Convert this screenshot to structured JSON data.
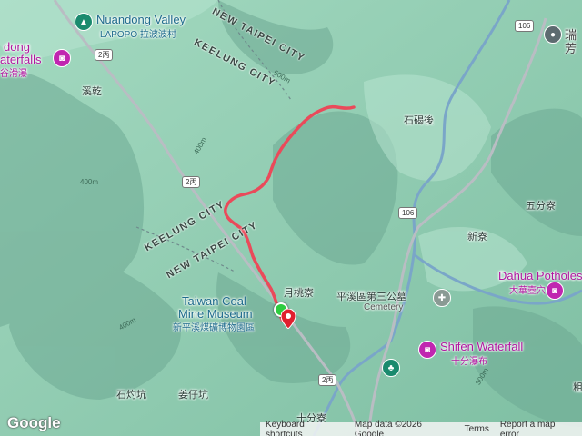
{
  "colors": {
    "track": "#ea4a5a",
    "water": "#7aa6c8",
    "road": "#b9bdc3",
    "terrain": "#8fcfb3"
  },
  "places": {
    "nuandong_valley_en": "Nuandong Valley",
    "nuandong_valley_zh": "LAPOPO 拉波波村",
    "waterfalls_en_1": "dong",
    "waterfalls_en_2": "aterfalls",
    "waterfalls_zh": "谷滑瀑",
    "xigan": "溪乾",
    "shikehou": "石碣後",
    "wufenliao": "五分寮",
    "xinliao": "新寮",
    "dahua_en": "Dahua Potholes",
    "dahua_zh": "大華壺穴",
    "yuetaoliao": "月桃寮",
    "cemetery_zh": "平溪區第三公墓",
    "cemetery_en": "Cemetery",
    "coal_mine_en_1": "Taiwan Coal",
    "coal_mine_en_2": "Mine Museum",
    "coal_mine_zh": "新平溪煤礦博物園區",
    "shifen_waterfall_en": "Shifen Waterfall",
    "shifen_waterfall_zh": "十分瀑布",
    "shizhuokeng": "石灼坑",
    "jiangzikeng": "姜仔坑",
    "shifenliao": "十分寮",
    "rui_1": "瑞",
    "rui_2": "芳",
    "gui": "粗"
  },
  "boundaries": {
    "new_taipei_top": "NEW TAIPEI CITY",
    "keelung_top": "KEELUNG CITY",
    "keelung_mid": "KEELUNG CITY",
    "new_taipei_mid": "NEW TAIPEI CITY"
  },
  "contours": [
    "400m",
    "400m",
    "400m",
    "500m",
    "300m"
  ],
  "roads": {
    "r2bing_a": "2丙",
    "r2bing_b": "2丙",
    "r2bing_c": "2丙",
    "r106_a": "106",
    "r106_b": "106"
  },
  "footer": {
    "logo": "Google",
    "shortcuts": "Keyboard shortcuts",
    "map_data": "Map data ©2026 Google",
    "terms": "Terms",
    "report": "Report a map error"
  }
}
